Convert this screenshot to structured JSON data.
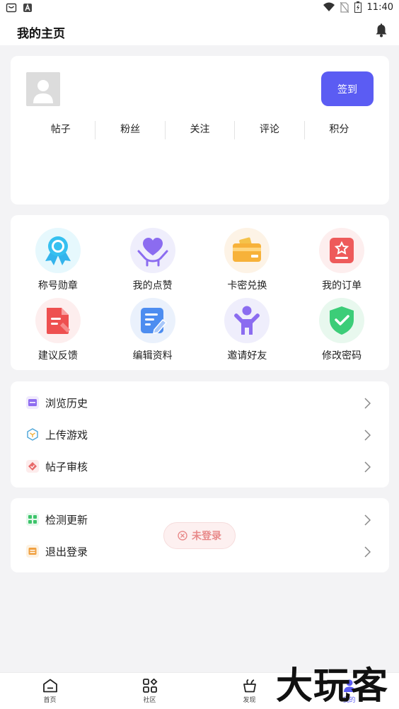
{
  "status_bar": {
    "time": "11:40"
  },
  "header": {
    "title": "我的主页"
  },
  "profile": {
    "checkin_label": "签到",
    "stats": [
      "帖子",
      "粉丝",
      "关注",
      "评论",
      "积分"
    ]
  },
  "features": [
    {
      "label": "称号勋章",
      "icon": "medal-icon",
      "bg": "#e6f8fd"
    },
    {
      "label": "我的点赞",
      "icon": "heart-hand-icon",
      "bg": "#efeefc"
    },
    {
      "label": "卡密兑换",
      "icon": "card-icon",
      "bg": "#fdf3e6"
    },
    {
      "label": "我的订单",
      "icon": "order-icon",
      "bg": "#fdeeee"
    },
    {
      "label": "建议反馈",
      "icon": "feedback-icon",
      "bg": "#fdeeee"
    },
    {
      "label": "编辑资料",
      "icon": "edit-icon",
      "bg": "#eaf1fc"
    },
    {
      "label": "邀请好友",
      "icon": "invite-icon",
      "bg": "#efeefc"
    },
    {
      "label": "修改密码",
      "icon": "shield-icon",
      "bg": "#e8f8ee"
    }
  ],
  "menu1": [
    {
      "label": "浏览历史",
      "icon": "history-icon",
      "color": "#8f6df0"
    },
    {
      "label": "上传游戏",
      "icon": "upload-icon",
      "color": "#4aa4d8"
    },
    {
      "label": "帖子审核",
      "icon": "review-icon",
      "color": "#e86a6a"
    }
  ],
  "menu2": [
    {
      "label": "检测更新",
      "icon": "update-icon",
      "color": "#3cc46a"
    },
    {
      "label": "退出登录",
      "icon": "logout-icon",
      "color": "#f0a040"
    }
  ],
  "toast": {
    "text": "未登录"
  },
  "tabs": [
    {
      "label": "首页",
      "icon": "home-icon"
    },
    {
      "label": "社区",
      "icon": "community-icon"
    },
    {
      "label": "发现",
      "icon": "discover-icon"
    },
    {
      "label": "我的",
      "icon": "mine-icon"
    }
  ],
  "watermark": "大玩客"
}
